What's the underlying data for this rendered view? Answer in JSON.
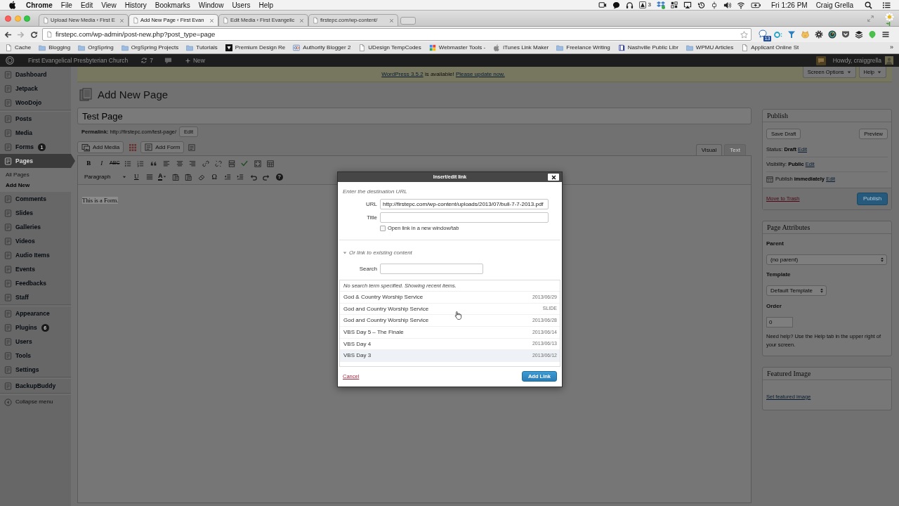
{
  "menu_bar": {
    "app": "Chrome",
    "menus": [
      "File",
      "Edit",
      "View",
      "History",
      "Bookmarks",
      "Window",
      "Users",
      "Help"
    ],
    "status_count": "3",
    "clock": "Fri 1:26 PM",
    "user": "Craig Grella"
  },
  "tabs": [
    {
      "title": "Upload New Media ‹ First E",
      "selected": false
    },
    {
      "title": "Add New Page ‹ First Evan",
      "selected": true
    },
    {
      "title": "Edit Media ‹ First Evangelic",
      "selected": false
    },
    {
      "title": "firstepc.com/wp-content/",
      "selected": false
    }
  ],
  "address_bar": {
    "url": "firstepc.com/wp-admin/post-new.php?post_type=page",
    "extension_badge": "13"
  },
  "bookmarks": [
    {
      "label": "Cache",
      "kind": "page"
    },
    {
      "label": "Blogging",
      "kind": "folder"
    },
    {
      "label": "OrgSpring",
      "kind": "folder"
    },
    {
      "label": "OrgSpring Projects",
      "kind": "folder"
    },
    {
      "label": "Tutorials",
      "kind": "folder"
    },
    {
      "label": "Premium Design Re",
      "kind": "dark-tile"
    },
    {
      "label": "Authority Blogger 2",
      "kind": "ring-tile"
    },
    {
      "label": "UDesign TempCodes",
      "kind": "page"
    },
    {
      "label": "Webmaster Tools -",
      "kind": "squares"
    },
    {
      "label": "iTunes Link Maker",
      "kind": "apple"
    },
    {
      "label": "Freelance Writing",
      "kind": "folder"
    },
    {
      "label": "Nashville Public Libr",
      "kind": "book"
    },
    {
      "label": "WPMU Articles",
      "kind": "folder"
    },
    {
      "label": "Applicant Online St",
      "kind": "page"
    }
  ],
  "bookmarks_more": "»",
  "admin_bar": {
    "site": "First Evangelical Presbyterian Church",
    "updates": "7",
    "new": "New",
    "greeting": "Howdy, craiggrella"
  },
  "sidebar": {
    "groups": [
      [
        {
          "label": "Dashboard",
          "selected": false
        },
        {
          "label": "Jetpack",
          "selected": false
        },
        {
          "label": "WooDojo",
          "selected": false
        }
      ],
      [
        {
          "label": "Posts",
          "selected": false
        },
        {
          "label": "Media",
          "selected": false
        },
        {
          "label": "Forms",
          "selected": false,
          "badge": "1"
        },
        {
          "label": "Pages",
          "selected": true,
          "children": [
            {
              "label": "All Pages",
              "selected": false
            },
            {
              "label": "Add New",
              "selected": true
            }
          ]
        },
        {
          "label": "Comments",
          "selected": false
        },
        {
          "label": "Slides",
          "selected": false
        },
        {
          "label": "Galleries",
          "selected": false
        },
        {
          "label": "Videos",
          "selected": false
        },
        {
          "label": "Audio Items",
          "selected": false
        },
        {
          "label": "Events",
          "selected": false
        },
        {
          "label": "Feedbacks",
          "selected": false
        },
        {
          "label": "Staff",
          "selected": false
        }
      ],
      [
        {
          "label": "Appearance",
          "selected": false
        },
        {
          "label": "Plugins",
          "selected": false,
          "badge": "6"
        },
        {
          "label": "Users",
          "selected": false
        },
        {
          "label": "Tools",
          "selected": false
        },
        {
          "label": "Settings",
          "selected": false
        }
      ],
      [
        {
          "label": "BackupBuddy",
          "selected": false
        }
      ]
    ],
    "collapse": "Collapse menu"
  },
  "notice": {
    "version_link": "WordPress 3.5.2",
    "text": "is available!",
    "update_link": "Please update now."
  },
  "screen_tabs": [
    "Screen Options",
    "Help"
  ],
  "heading": "Add New Page",
  "title_field": {
    "value": "Test Page"
  },
  "permalink": {
    "label": "Permalink:",
    "url": "http://firstepc.com/test-page/",
    "button": "Edit"
  },
  "media_buttons": [
    "Add Media",
    "Add Form"
  ],
  "editor_tabs": [
    {
      "label": "Visual",
      "selected": true
    },
    {
      "label": "Text",
      "selected": false
    }
  ],
  "toolbar": {
    "bold": "B",
    "italic": "I",
    "strike": "ABC",
    "format": "Paragraph",
    "underline": "U",
    "font_color": "A",
    "charmap": "Ω",
    "help": "?"
  },
  "content": {
    "text": "This is a Form.",
    "highlighted": true
  },
  "publish": {
    "title": "Publish",
    "save_draft": "Save Draft",
    "preview": "Preview",
    "rows": [
      {
        "kind": "plain",
        "label": "Status:",
        "value": "Draft",
        "edit": "Edit"
      },
      {
        "kind": "plain",
        "label": "Visibility:",
        "value": "Public",
        "edit": "Edit"
      },
      {
        "kind": "dated",
        "label": "Publish",
        "value": "immediately",
        "edit": "Edit"
      }
    ],
    "trash": "Move to Trash",
    "button": "Publish"
  },
  "page_attributes": {
    "title": "Page Attributes",
    "parent_label": "Parent",
    "parent": "(no parent)",
    "template_label": "Template",
    "template": "Default Template",
    "order_label": "Order",
    "order": "0",
    "help": "Need help? Use the Help tab in the upper right of your screen."
  },
  "featured_image": {
    "title": "Featured Image",
    "link": "Set featured image"
  },
  "dialog": {
    "title": "Insert/edit link",
    "intro": "Enter the destination URL",
    "url": {
      "label": "URL",
      "value": "http://firstepc.com/wp-content/uploads/2013/07/bull-7-7-2013.pdf"
    },
    "link_title": {
      "label": "Title"
    },
    "new_window": {
      "label": "Open link in a new window/tab",
      "checked": false
    },
    "existing": {
      "label": "Or link to existing content",
      "expanded": true
    },
    "search": {
      "label": "Search"
    },
    "notice": "No search term specified. Showing recent items.",
    "results": [
      {
        "title": "God & Country Worship Service",
        "info": "2013/06/29",
        "selected": false
      },
      {
        "title": "God and Country Worship Service",
        "info": "SLIDE",
        "selected": false
      },
      {
        "title": "God and Country Worship Service",
        "info": "2013/06/28",
        "selected": false
      },
      {
        "title": "VBS Day 5 – The Finale",
        "info": "2013/06/14",
        "selected": false
      },
      {
        "title": "VBS Day 4",
        "info": "2013/06/13",
        "selected": false
      },
      {
        "title": "VBS Day 3",
        "info": "2013/06/12",
        "selected": true
      }
    ],
    "cancel": "Cancel",
    "submit": "Add Link"
  }
}
